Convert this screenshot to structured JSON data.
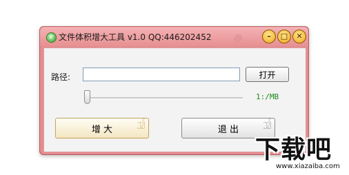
{
  "window": {
    "title": "文件体积增大工具 v1.0  QQ:446202452",
    "minimize_glyph": "–",
    "maximize_glyph": "□",
    "close_glyph": "✕"
  },
  "form": {
    "path_label": "路径:",
    "path_value": "",
    "open_button": "打开",
    "size_readout": "1:/MB",
    "slider_value": 0
  },
  "actions": {
    "enlarge_button": "增 大",
    "exit_button": "退 出"
  },
  "watermark": {
    "brand": "下载吧",
    "url": "www.xiazaiba.com"
  },
  "icons": [
    "app-icon",
    "minimize-icon",
    "maximize-icon",
    "close-icon",
    "swirl-ornament-icon"
  ],
  "colors": {
    "frame": "#e58d90",
    "readout": "#1d8a1d",
    "window_buttons": "#f0a81c"
  }
}
